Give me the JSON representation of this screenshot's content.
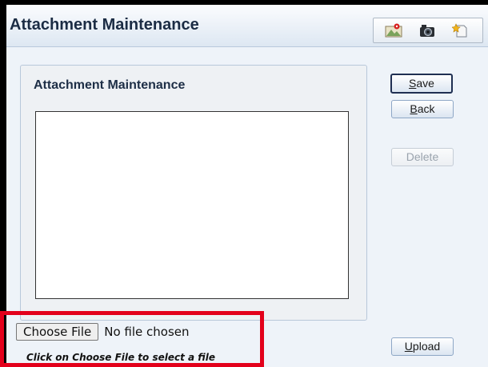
{
  "window": {
    "title": "Attachment Maintenance",
    "toolbar_icons": [
      "map-icon",
      "camera-icon",
      "document-star-icon"
    ]
  },
  "panel": {
    "title": "Attachment Maintenance"
  },
  "buttons": {
    "save": "Save",
    "save_accesskey": "S",
    "back": "Back",
    "back_accesskey": "B",
    "delete": "Delete",
    "upload": "Upload",
    "upload_accesskey": "U"
  },
  "file_input": {
    "button_label": "Choose File",
    "status": "No file chosen",
    "hint": "Click on Choose File to select a file"
  },
  "colors": {
    "highlight_border": "#e3001b",
    "primary_border": "#1f2f52"
  }
}
